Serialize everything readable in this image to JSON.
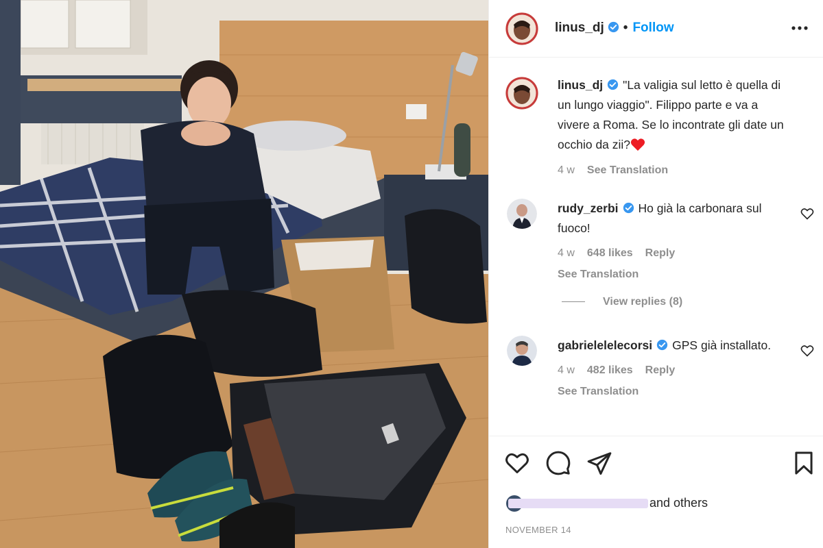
{
  "post": {
    "username": "linus_dj",
    "follow_label": "Follow",
    "separator": "•",
    "more_icon": "more-horizontal-icon"
  },
  "caption": {
    "username": "linus_dj",
    "text": "\"La valigia sul letto è quella di un lungo viaggio\". Filippo parte e va a vivere a Roma. Se lo incontrate gli date un occhio da zii?",
    "emoji": "red-heart-icon",
    "time": "4 w",
    "translation_label": "See Translation"
  },
  "comments": [
    {
      "username": "rudy_zerbi",
      "text": "Ho già la carbonara sul fuoco!",
      "time": "4 w",
      "likes": "648 likes",
      "reply_label": "Reply",
      "translation_label": "See Translation"
    },
    {
      "username": "gabrielelelecorsi",
      "text": "GPS già installato.",
      "time": "4 w",
      "likes": "482 likes",
      "reply_label": "Reply",
      "translation_label": "See Translation"
    }
  ],
  "view_replies": "View replies (8)",
  "likes_suffix": "and others",
  "date": "NOVEMBER 14",
  "colors": {
    "link_blue": "#0095f6",
    "muted_gray": "#8e8e8e",
    "text_dark": "#262626",
    "heart_red": "#ed1c24"
  }
}
